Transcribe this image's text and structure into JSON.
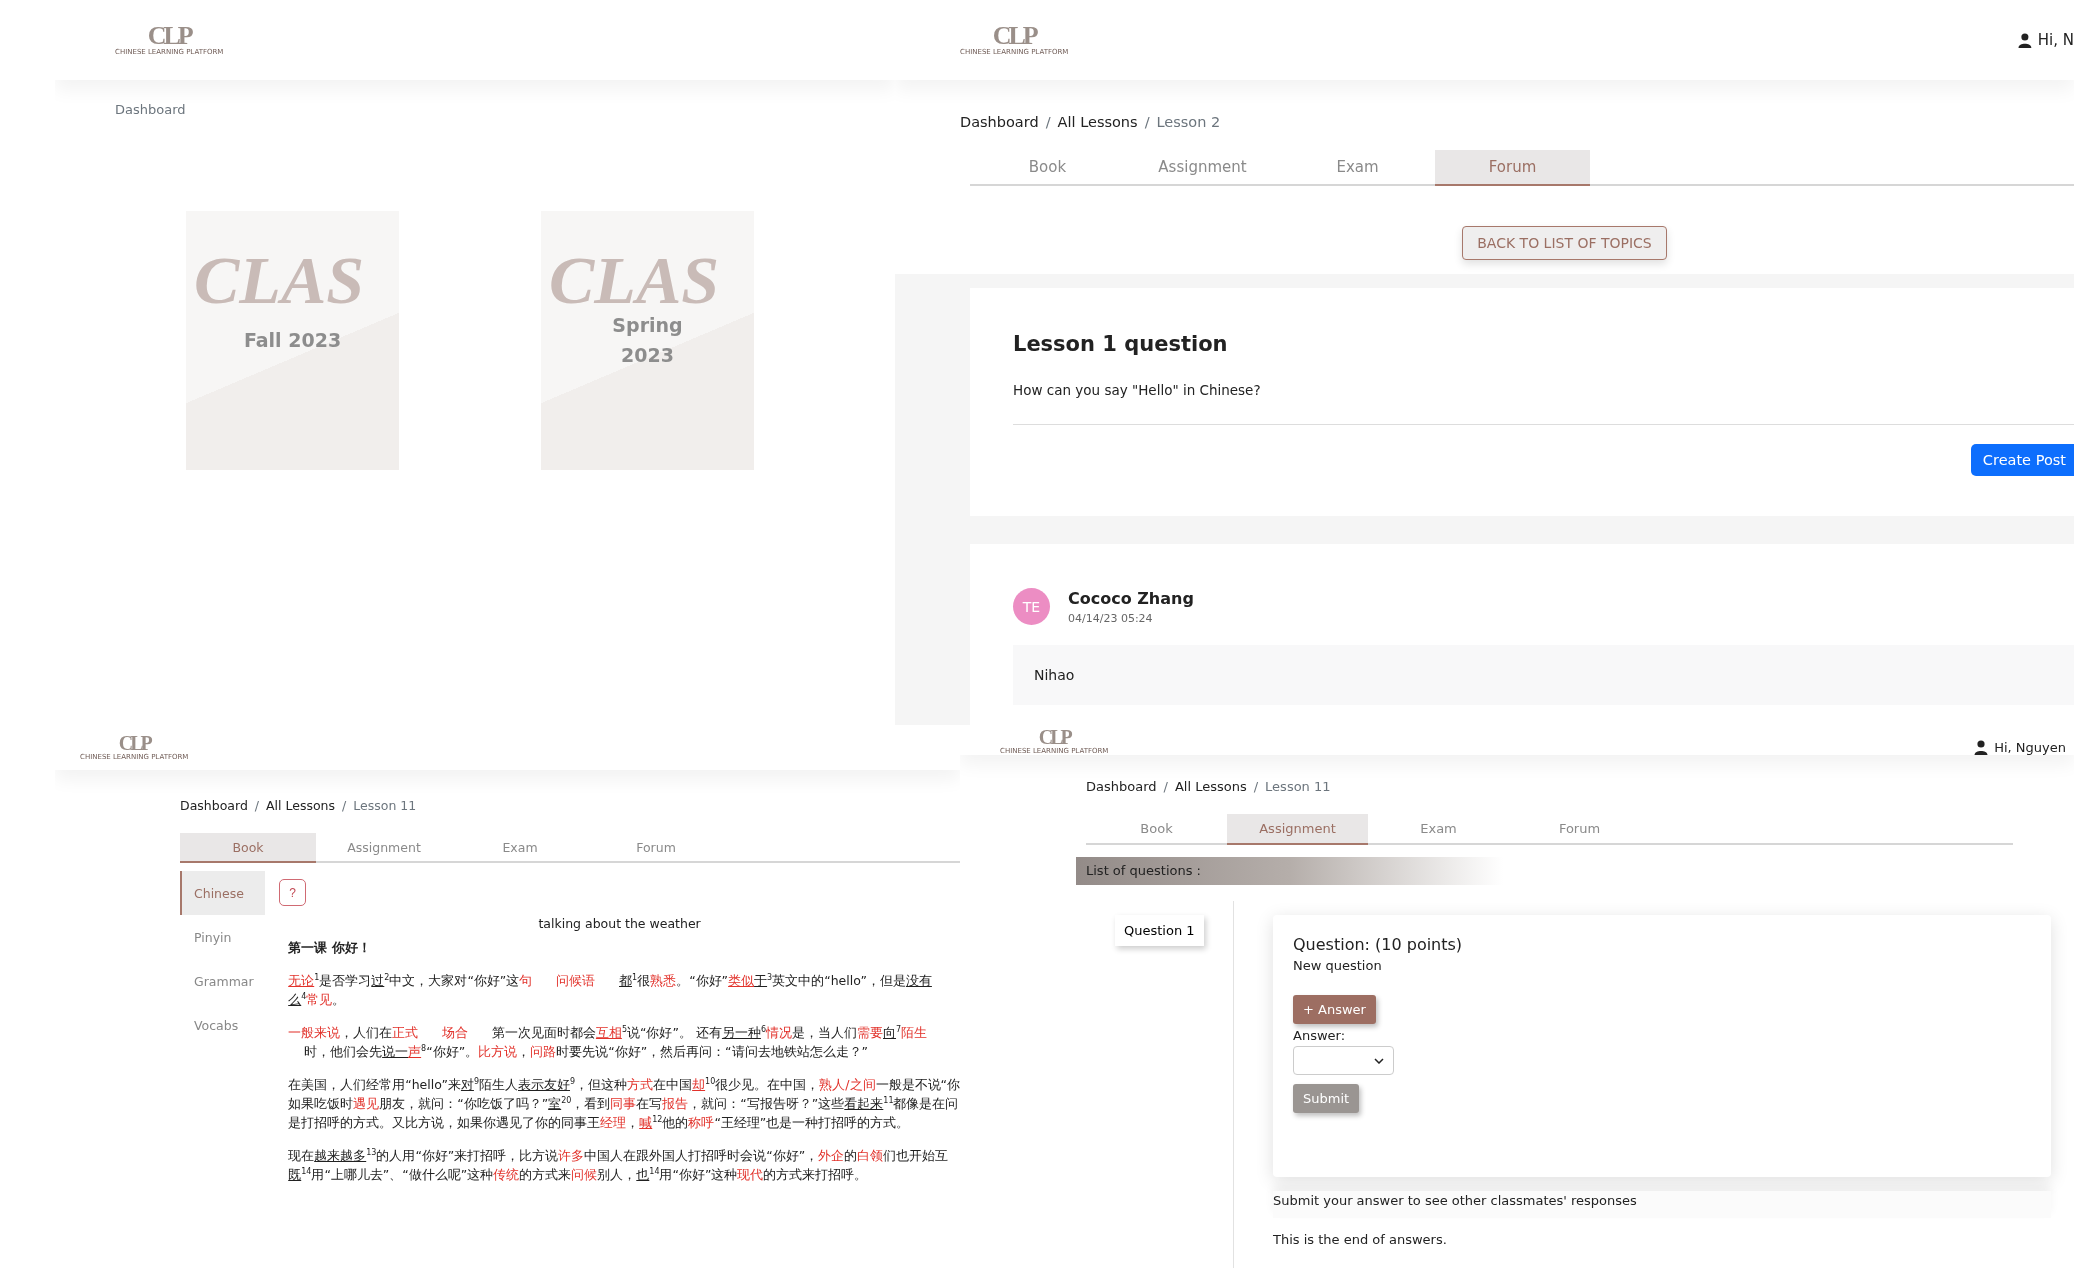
{
  "dashboard": {
    "logo": {
      "mark": "CLP",
      "tagline": "CHINESE LEARNING PLATFORM"
    },
    "breadcrumb": [
      {
        "text": "Dashboard",
        "kind": "current"
      }
    ],
    "classes": [
      {
        "title": "Fall 2023",
        "watermark": "CLAS"
      },
      {
        "title": "Spring 2023",
        "watermark": "CLAS"
      }
    ]
  },
  "forum_page": {
    "logo": {
      "mark": "CLP",
      "tagline": "CHINESE LEARNING PLATFORM"
    },
    "user": "Hi, N",
    "breadcrumb": [
      {
        "text": "Dashboard",
        "kind": "link"
      },
      {
        "text": "/",
        "kind": "separator"
      },
      {
        "text": "All Lessons",
        "kind": "link"
      },
      {
        "text": "/",
        "kind": "separator"
      },
      {
        "text": "Lesson 2",
        "kind": "current"
      }
    ],
    "tabs": [
      {
        "label": "Book",
        "selected": false
      },
      {
        "label": "Assignment",
        "selected": false
      },
      {
        "label": "Exam",
        "selected": false
      },
      {
        "label": "Forum",
        "selected": true
      }
    ],
    "back_button": "BACK TO LIST OF TOPICS",
    "topic": {
      "title": "Lesson 1 question",
      "question": "How can you say \"Hello\" in Chinese?",
      "create_button": "Create Post"
    },
    "posts": [
      {
        "initials": "TE",
        "author": "Cococo Zhang",
        "time": "04/14/23 05:24",
        "message": "Nihao"
      }
    ]
  },
  "book_page": {
    "logo": {
      "mark": "CLP",
      "tagline": "CHINESE LEARNING PLATFORM"
    },
    "breadcrumb": [
      {
        "text": "Dashboard",
        "kind": "link"
      },
      {
        "text": "/",
        "kind": "separator"
      },
      {
        "text": "All Lessons",
        "kind": "link"
      },
      {
        "text": "/",
        "kind": "separator"
      },
      {
        "text": "Lesson 11",
        "kind": "current"
      }
    ],
    "tabs": [
      {
        "label": "Book",
        "selected": true
      },
      {
        "label": "Assignment",
        "selected": false
      },
      {
        "label": "Exam",
        "selected": false
      },
      {
        "label": "Forum",
        "selected": false
      }
    ],
    "side_tabs": [
      {
        "label": "Chinese",
        "selected": true
      },
      {
        "label": "Pinyin",
        "selected": false
      },
      {
        "label": "Grammar",
        "selected": false
      },
      {
        "label": "Vocabs",
        "selected": false
      }
    ],
    "help_button": "?",
    "heading": "talking about the weather",
    "lesson_title": "第一课 你好！",
    "paragraphs": [
      {
        "lines": [
          [
            {
              "text": "无论",
              "kind": "red_underline"
            },
            {
              "text": "$^{1}$是否学习",
              "kind": "plain"
            },
            {
              "text": "过",
              "kind": "underline"
            },
            {
              "text": "$^{2}$中文，大家对“你好”这",
              "kind": "plain"
            },
            {
              "text": "句      问候语      ",
              "kind": "red"
            },
            {
              "text": "都",
              "kind": "underline"
            },
            {
              "text": "$^{1}$很",
              "kind": "plain"
            },
            {
              "text": "熟悉",
              "kind": "red"
            },
            {
              "text": "。“你好”",
              "kind": "plain"
            },
            {
              "text": "类似",
              "kind": "red_underline"
            },
            {
              "text": "于",
              "kind": "underline"
            },
            {
              "text": "$^{3}$英文中的“hello”，但是",
              "kind": "plain"
            },
            {
              "text": "没有",
              "kind": "underline"
            }
          ],
          [
            {
              "text": "么",
              "kind": "underline"
            },
            {
              "text": "$^{4}$",
              "kind": "plain"
            },
            {
              "text": "常见",
              "kind": "red"
            },
            {
              "text": "。",
              "kind": "plain"
            }
          ]
        ]
      },
      {
        "lines": [
          [
            {
              "text": "一般来说",
              "kind": "red"
            },
            {
              "text": "，人们在",
              "kind": "plain"
            },
            {
              "text": "正式      场合",
              "kind": "red"
            },
            {
              "text": "      第一次见面时都会",
              "kind": "plain"
            },
            {
              "text": "互相",
              "kind": "red_underline"
            },
            {
              "text": "$^{5}$说“你好”。 还有",
              "kind": "plain"
            },
            {
              "text": "另一种",
              "kind": "underline"
            },
            {
              "text": "$^{6}$",
              "kind": "plain"
            },
            {
              "text": "情况",
              "kind": "red"
            },
            {
              "text": "是，当人们",
              "kind": "plain"
            },
            {
              "text": "需要",
              "kind": "red"
            },
            {
              "text": "向",
              "kind": "underline"
            },
            {
              "text": "$^{7}$",
              "kind": "plain"
            },
            {
              "text": "陌生",
              "kind": "red"
            }
          ],
          [
            {
              "text": "    时，他们会先",
              "kind": "plain"
            },
            {
              "text": "说一",
              "kind": "underline"
            },
            {
              "text": "声",
              "kind": "red_underline"
            },
            {
              "text": "$^{8}$“你好”。",
              "kind": "plain"
            },
            {
              "text": "比方说",
              "kind": "red"
            },
            {
              "text": "，",
              "kind": "plain"
            },
            {
              "text": "问路",
              "kind": "red"
            },
            {
              "text": "时要先说“你好”，然后再问：“请问去地铁站怎么走？”",
              "kind": "plain"
            }
          ]
        ]
      },
      {
        "lines": [
          [
            {
              "text": "在美国，人们经常用“hello”来",
              "kind": "plain"
            },
            {
              "text": "对",
              "kind": "underline"
            },
            {
              "text": "$^{9}$陌生人",
              "kind": "plain"
            },
            {
              "text": "表示友好",
              "kind": "underline"
            },
            {
              "text": "$^{9}$，但这种",
              "kind": "plain"
            },
            {
              "text": "方式",
              "kind": "red"
            },
            {
              "text": "在中国",
              "kind": "plain"
            },
            {
              "text": "却",
              "kind": "red_underline"
            },
            {
              "text": "$^{10}$很少见。在中国，",
              "kind": "plain"
            },
            {
              "text": "熟人/之间",
              "kind": "red"
            },
            {
              "text": "一般是不说“你",
              "kind": "plain"
            }
          ],
          [
            {
              "text": "如果吃饭时",
              "kind": "plain"
            },
            {
              "text": "遇见",
              "kind": "red"
            },
            {
              "text": "朋友，就问：“你吃饭了吗？”",
              "kind": "plain"
            },
            {
              "text": "室",
              "kind": "underline"
            },
            {
              "text": "$^{20}$，看到",
              "kind": "plain"
            },
            {
              "text": "同事",
              "kind": "red"
            },
            {
              "text": "在写",
              "kind": "plain"
            },
            {
              "text": "报告",
              "kind": "red"
            },
            {
              "text": "，就问：“写报告呀？”这些",
              "kind": "plain"
            },
            {
              "text": "看起来",
              "kind": "underline"
            },
            {
              "text": "$^{11}$都像是在问",
              "kind": "plain"
            }
          ],
          [
            {
              "text": "是打招呼的方式。又比方说，如果你遇见了你的同事王",
              "kind": "plain"
            },
            {
              "text": "经理",
              "kind": "red"
            },
            {
              "text": "，",
              "kind": "plain"
            },
            {
              "text": "喊",
              "kind": "red_underline"
            },
            {
              "text": "$^{12}$他的",
              "kind": "plain"
            },
            {
              "text": "称呼",
              "kind": "red"
            },
            {
              "text": "“王经理”也是一种打招呼的方式。",
              "kind": "plain"
            }
          ]
        ]
      },
      {
        "lines": [
          [
            {
              "text": "现在",
              "kind": "plain"
            },
            {
              "text": "越来越多",
              "kind": "underline"
            },
            {
              "text": "$^{13}$的人用“你好”来打招呼，比方说",
              "kind": "plain"
            },
            {
              "text": "许多",
              "kind": "red"
            },
            {
              "text": "中国人在跟外国人打招呼时会说“你好”，",
              "kind": "plain"
            },
            {
              "text": "外企",
              "kind": "red"
            },
            {
              "text": "的",
              "kind": "plain"
            },
            {
              "text": "白领",
              "kind": "red"
            },
            {
              "text": "们也开始互",
              "kind": "plain"
            }
          ],
          [
            {
              "text": "既",
              "kind": "underline"
            },
            {
              "text": "$^{14}$用“上哪儿去”、“做什么呢”这种",
              "kind": "plain"
            },
            {
              "text": "传统",
              "kind": "red"
            },
            {
              "text": "的方式来",
              "kind": "plain"
            },
            {
              "text": "问候",
              "kind": "red"
            },
            {
              "text": "别人，",
              "kind": "plain"
            },
            {
              "text": "也",
              "kind": "underline"
            },
            {
              "text": "$^{14}$用“你好”这种",
              "kind": "plain"
            },
            {
              "text": "现代",
              "kind": "red"
            },
            {
              "text": "的方式来打招呼。",
              "kind": "plain"
            }
          ]
        ]
      }
    ]
  },
  "assignment_page": {
    "logo": {
      "mark": "CLP",
      "tagline": "CHINESE LEARNING PLATFORM"
    },
    "user": "Hi, Nguyen",
    "breadcrumb": [
      {
        "text": "Dashboard",
        "kind": "link"
      },
      {
        "text": "/",
        "kind": "separator"
      },
      {
        "text": "All Lessons",
        "kind": "link"
      },
      {
        "text": "/",
        "kind": "separator"
      },
      {
        "text": "Lesson 11",
        "kind": "current"
      }
    ],
    "tabs": [
      {
        "label": "Book",
        "selected": false
      },
      {
        "label": "Assignment",
        "selected": true
      },
      {
        "label": "Exam",
        "selected": false
      },
      {
        "label": "Forum",
        "selected": false
      }
    ],
    "list_header": "List of questions :",
    "questions": [
      {
        "label": "Question 1",
        "selected": true
      }
    ],
    "question": {
      "title": "Question: (10 points)",
      "text": "New question",
      "add_answer_button": "+ Answer",
      "answer_label": "Answer:",
      "submit": {
        "label": "Submit",
        "disabled": true
      }
    },
    "notice": "Submit your answer to see other classmates' responses",
    "end_text": "This is the end of answers."
  }
}
